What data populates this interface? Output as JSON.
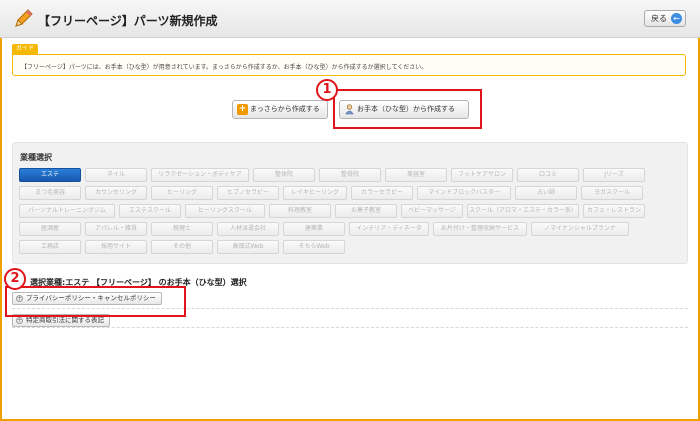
{
  "header": {
    "title": "【フリーページ】パーツ新規作成",
    "back_label": "戻る",
    "icons": {
      "title": "pencil-icon",
      "back": "arrow-left-icon"
    }
  },
  "guide": {
    "tag": "ガイド",
    "text": "【フリーページ】パーツには、お手本（ひな型）が用意されています。まっさらから作成するか、お手本（ひな型）から作成するか選択してください。"
  },
  "actions": {
    "scratch_label": "まっさらから作成する",
    "template_label": "お手本（ひな型）から作成する"
  },
  "annotations": {
    "badge_1": "1",
    "badge_2": "2",
    "color": "#e0141b"
  },
  "industry": {
    "heading": "業種選択",
    "chips": [
      {
        "label": "エステ",
        "active": true
      },
      {
        "label": "ネイル",
        "active": false
      },
      {
        "label": "リラクゼーション・ボディケア",
        "active": false
      },
      {
        "label": "整体院",
        "active": false
      },
      {
        "label": "整骨院",
        "active": false
      },
      {
        "label": "美容室",
        "active": false
      },
      {
        "label": "フットケアサロン",
        "active": false
      },
      {
        "label": "口コミ",
        "active": false
      },
      {
        "label": "Jリーズ",
        "active": false
      },
      {
        "label": "まつ毛美容",
        "active": false
      },
      {
        "label": "カウンセリング",
        "active": false
      },
      {
        "label": "ヒーリング",
        "active": false
      },
      {
        "label": "ヒプノセラピー",
        "active": false
      },
      {
        "label": "レイキヒーリング",
        "active": false
      },
      {
        "label": "カラーセラピー",
        "active": false
      },
      {
        "label": "マインドブロックバスター",
        "active": false
      },
      {
        "label": "占い師",
        "active": false
      },
      {
        "label": "ヨガスクール",
        "active": false
      },
      {
        "label": "パーソナルトレーニングジム",
        "active": false
      },
      {
        "label": "エステスクール",
        "active": false
      },
      {
        "label": "ヒーリングスクール",
        "active": false
      },
      {
        "label": "料理教室",
        "active": false
      },
      {
        "label": "お菓子教室",
        "active": false
      },
      {
        "label": "ベビーマッサージ",
        "active": false
      },
      {
        "label": "スクール（アロマ・エステ・カラー系）",
        "active": false
      },
      {
        "label": "カフェ・レストラン",
        "active": false
      },
      {
        "label": "居酒屋",
        "active": false
      },
      {
        "label": "アパレル・雑貨",
        "active": false
      },
      {
        "label": "税理士",
        "active": false
      },
      {
        "label": "人材派遣会社",
        "active": false
      },
      {
        "label": "建築業",
        "active": false
      },
      {
        "label": "インテリア・ディネータ",
        "active": false
      },
      {
        "label": "お片付け・整理収納サービス",
        "active": false
      },
      {
        "label": "ノマイナンシャルプランナ",
        "active": false
      },
      {
        "label": "工務店",
        "active": false
      },
      {
        "label": "採用サイト",
        "active": false
      },
      {
        "label": "その他",
        "active": false
      },
      {
        "label": "高畑式Web",
        "active": false
      },
      {
        "label": "そちらWeb",
        "active": false
      }
    ]
  },
  "templates": {
    "section_title": "選択業種:エステ 【フリーページ】 のお手本（ひな型）選択",
    "items": [
      {
        "label": "プライバシーポリシー・キャンセルポリシー"
      },
      {
        "label": "特定商取引法に関する表記"
      }
    ]
  }
}
